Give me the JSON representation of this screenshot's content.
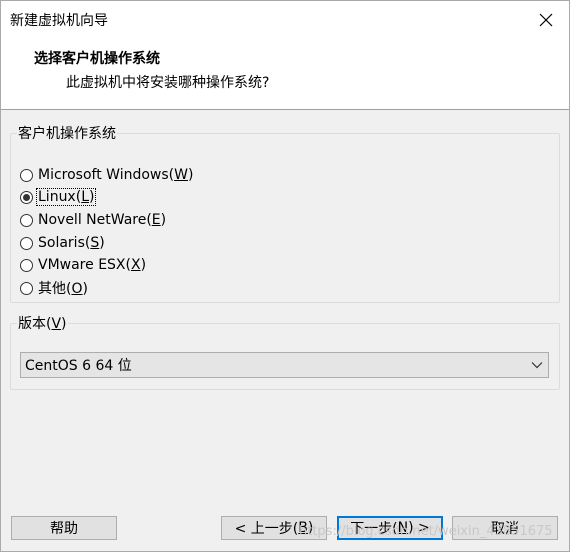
{
  "window": {
    "title": "新建虚拟机向导"
  },
  "header": {
    "title": "选择客户机操作系统",
    "subtitle": "此虚拟机中将安装哪种操作系统?"
  },
  "guest_os": {
    "legend": "客户机操作系统",
    "selected_index": 1,
    "options": [
      {
        "label": "Microsoft Windows(",
        "accel": "W",
        "suffix": ")"
      },
      {
        "label": "Linux(",
        "accel": "L",
        "suffix": ")"
      },
      {
        "label": "Novell NetWare(",
        "accel": "E",
        "suffix": ")"
      },
      {
        "label": "Solaris(",
        "accel": "S",
        "suffix": ")"
      },
      {
        "label": "VMware ESX(",
        "accel": "X",
        "suffix": ")"
      },
      {
        "label": "其他(",
        "accel": "O",
        "suffix": ")"
      }
    ]
  },
  "version": {
    "legend_prefix": "版本(",
    "legend_accel": "V",
    "legend_suffix": ")",
    "selected": "CentOS 6 64 位"
  },
  "buttons": {
    "help": "帮助",
    "back_prefix": "< 上一步(",
    "back_accel": "B",
    "back_suffix": ")",
    "next_prefix": "下一步(",
    "next_accel": "N",
    "next_suffix": ") >",
    "cancel": "取消"
  },
  "watermark": "https://blog.csdn.net/weixin_43851675",
  "colors": {
    "focus_border": "#0078d7",
    "panel_bg": "#f0f0f0"
  }
}
